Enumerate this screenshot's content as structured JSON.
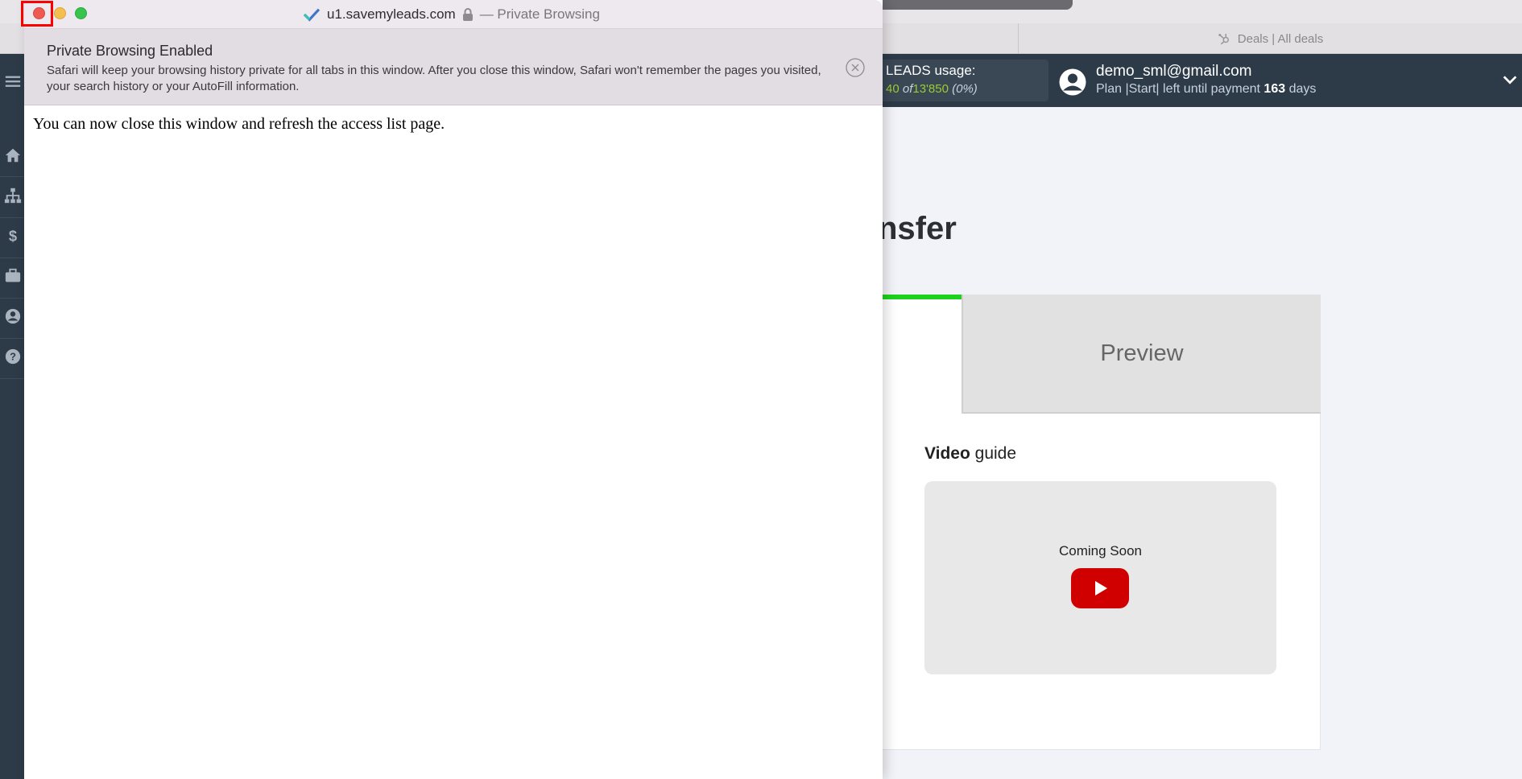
{
  "background": {
    "tab": {
      "label": "Deals | All deals"
    },
    "usage": {
      "title": "LEADS usage:",
      "used": "40",
      "of": "of",
      "total": "13'850",
      "percent": "(0%)"
    },
    "user": {
      "email": "demo_sml@gmail.com",
      "plan_prefix": "Plan |Start| left until payment",
      "days": "163",
      "days_suffix": "days"
    },
    "page_title_fragment": "nsfer",
    "tabs": {
      "preview": "Preview"
    },
    "video": {
      "label_bold": "Video",
      "label_rest": "guide",
      "coming_soon": "Coming Soon"
    },
    "sidebar_icons": [
      "menu-icon",
      "home-icon",
      "sitemap-icon",
      "dollar-icon",
      "briefcase-icon",
      "user-icon",
      "help-icon"
    ]
  },
  "private_window": {
    "title": "u1.savemyleads.com",
    "title_suffix": "— Private Browsing",
    "banner": {
      "title": "Private Browsing Enabled",
      "text": "Safari will keep your browsing history private for all tabs in this window. After you close this window, Safari won't remember the pages you visited, your search history or your AutoFill information."
    },
    "content": "You can now close this window and refresh the access list page."
  },
  "colors": {
    "accent_green": "#1ed11e",
    "header_bg": "#2d3a48",
    "close_red": "#ee5a52",
    "youtube_red": "#d10000"
  }
}
